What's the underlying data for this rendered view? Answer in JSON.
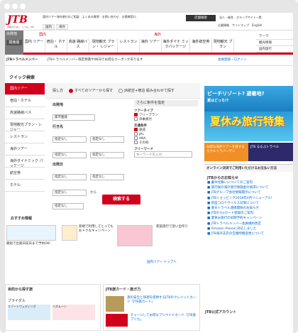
{
  "brand": {
    "logo": "JTB",
    "tagline": "感動のそばに、いつも。JTB",
    "accent": "#d1001c"
  },
  "header": {
    "links": [
      "国内ツアー海外旅行のご相談",
      "よくある質問",
      "お問い合わせ",
      "お客様窓口"
    ],
    "store_button": "店舗検索",
    "links_right": [
      "法人・総合",
      "グループサイト一覧"
    ],
    "row2": [
      "国内",
      "海外"
    ],
    "right2": [
      "企業情報",
      "サイトマップ",
      "English"
    ]
  },
  "nav": {
    "region_title": "出発地",
    "region_value": "関東版",
    "domestic_label": "国内",
    "overseas_label": "海外",
    "items": [
      "国内\nツアー",
      "宿泊・\nホテル",
      "高速\n路線バス",
      "現地観光\nプラン・\nレジャー",
      "レストラン",
      "海外\nツアー",
      "海外ダイナ\nミックパッケージ",
      "海外航空券",
      "現地観光\nプラン"
    ],
    "right": [
      "テーマ",
      "観光情報",
      "国内旅行",
      "海外旅行"
    ]
  },
  "member": {
    "label": "JTBトラベルメンバー",
    "promo": "JTBトラベルメンバー限定特典やWEBでお得なクーポンがあります",
    "right": "会員登録・ログイン"
  },
  "quick_search": {
    "title": "クイック検索",
    "side_label": "国内",
    "tabs": [
      "国内ツアー",
      "宿泊・ホテル",
      "高速路線バス",
      "現地観光プラン・レジャー",
      "レストラン",
      "海外ツアー",
      "海外ダイナミック\nパッケージ",
      "航空券",
      "ホテル",
      "海外オプショナルツアー"
    ],
    "search_type": "探し方",
    "options": [
      "すべてのツアーから探す",
      "JR航空+宿泊\n組み合わせて探す"
    ],
    "dep_label": "出発地",
    "dep_value": "都市圏発",
    "dest_label": "行き先",
    "dest_opts": [
      "指定なし",
      "指定なし",
      "指定なし",
      "指定なし"
    ],
    "date_label": "出発日",
    "date_value": "指定なし",
    "date_to": "から",
    "conditions_title": "さらに条件を指定",
    "tour_type": "ツアータイプ",
    "tour_types": [
      "フリープラン",
      "添乗員付"
    ],
    "transport": "交通条件",
    "transports": [
      "鉄道",
      "JAL",
      "ANA",
      "その他"
    ],
    "freeword": "フリーワード",
    "freeword_placeholder": "キーワードを入力",
    "search_button": "検索する"
  },
  "recommend": {
    "title": "おすすめ情報",
    "items": [
      "最短で出発日前日まで予約OK!",
      "新規で利用してとってもおトクなキャンペーン",
      "家族旅行で思い出作り"
    ],
    "more": "国内ツアー トップへ"
  },
  "lower_left": {
    "title": "目的から探す旅",
    "bridal": "ブライダル",
    "resort": "リゾートウェディング",
    "honeymoon": "ハネムーン"
  },
  "jtb_card": {
    "title": "JTB旅カード・旅ガ力",
    "lines": [
      "旅の安全と快適を提供するJTBのクレジットカード「JTB旅カード」",
      "チャージしてお得なプリペイドカード「JTB旅プリカ」"
    ]
  },
  "right": {
    "banner1": "ビーチリゾート? 避暑地?",
    "banner1b": "夏はどっち!?",
    "banner2": "夏休み旅行特集",
    "banner3a": "お得な海外ツアーを探すならウルトラバーゲン",
    "banner3b": "JTB るるぶトラベル",
    "notice": "オンライン決済でご利用いただけるお支払い方法",
    "news_title": "JTBからのお知らせ",
    "news": [
      "■ 暑中見舞いについてのご案内",
      "■ 旅行後の海外旅行保険金の請求について",
      "■ JTBグループ会社情報開示について",
      "■ JTBショッピング2018年4月リニューアル!",
      "■ 新型コロナウイルス対策について",
      "■ 楽天トラベル連携開始のお知らせ",
      "■ JTBからeカード登録のご案内",
      "■ 夏休み旅行の早期予約キャンペーン",
      "■ JTBトラベルメンバー会員規約改定",
      "■ Amazon Alexaに対応しました",
      "■ JTB海外支店の営業時間変更について"
    ],
    "corp": "JTB公式アカウント"
  }
}
